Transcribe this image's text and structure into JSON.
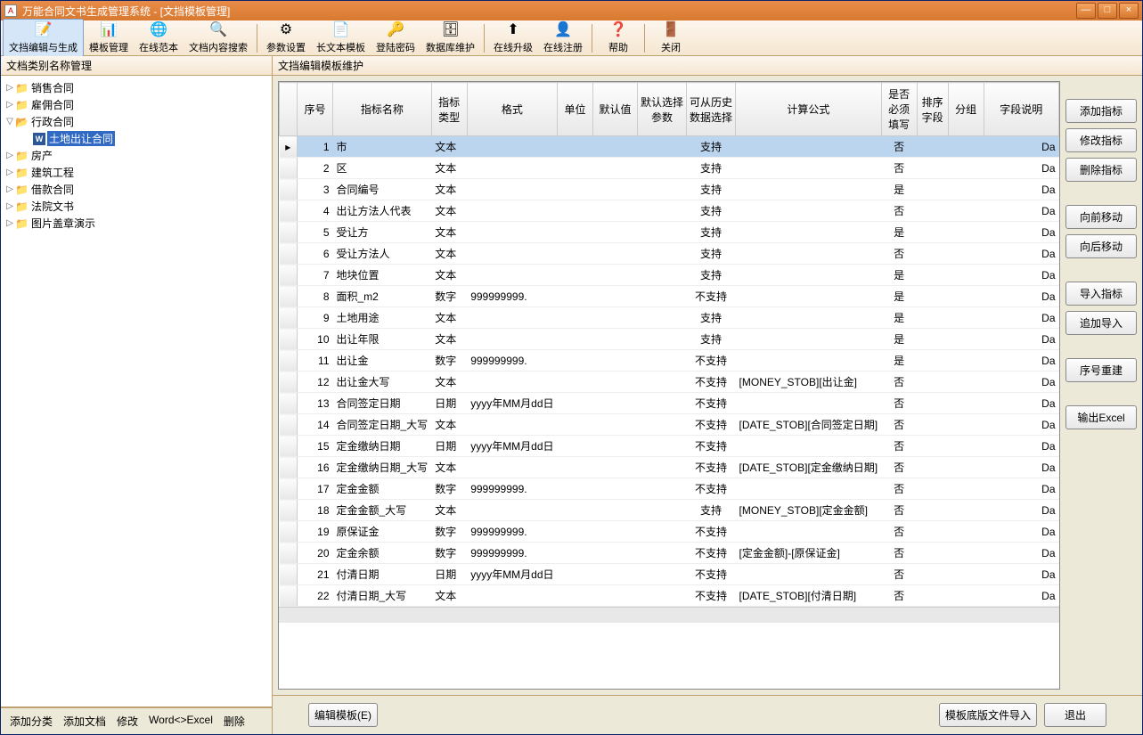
{
  "title": "万能合同文书生成管理系统 - [文挡模板管理]",
  "toolbar": [
    {
      "icon": "📝",
      "label": "文挡编辑与生成",
      "active": true
    },
    {
      "icon": "📊",
      "label": "模板管理"
    },
    {
      "icon": "🌐",
      "label": "在线范本"
    },
    {
      "icon": "🔍",
      "label": "文档内容搜索"
    },
    {
      "sep": true
    },
    {
      "icon": "⚙",
      "label": "参数设置"
    },
    {
      "icon": "📄",
      "label": "长文本模板"
    },
    {
      "icon": "🔑",
      "label": "登陆密码"
    },
    {
      "icon": "🗄",
      "label": "数据库维护"
    },
    {
      "sep": true
    },
    {
      "icon": "⬆",
      "label": "在线升级"
    },
    {
      "icon": "👤",
      "label": "在线注册"
    },
    {
      "sep": true
    },
    {
      "icon": "❓",
      "label": "帮助"
    },
    {
      "sep": true
    },
    {
      "icon": "🚪",
      "label": "关闭"
    }
  ],
  "leftHeader": "文档类别名称管理",
  "tree": [
    {
      "label": "销售合同",
      "icon": "📁",
      "toggle": "▷"
    },
    {
      "label": "雇佣合同",
      "icon": "📁",
      "toggle": "▷"
    },
    {
      "label": "行政合同",
      "icon": "📂",
      "toggle": "▽",
      "open": true,
      "children": [
        {
          "label": "土地出让合同",
          "icon": "W",
          "selected": true,
          "word": true
        }
      ]
    },
    {
      "label": "房产",
      "icon": "📁",
      "toggle": "▷"
    },
    {
      "label": "建筑工程",
      "icon": "📁",
      "toggle": "▷"
    },
    {
      "label": "借款合同",
      "icon": "📁",
      "toggle": "▷"
    },
    {
      "label": "法院文书",
      "icon": "📁",
      "toggle": "▷"
    },
    {
      "label": "图片盖章演示",
      "icon": "📁",
      "toggle": "▷"
    }
  ],
  "leftFooter": [
    "添加分类",
    "添加文档",
    "修改",
    "Word<>Excel",
    "删除"
  ],
  "rightHeader": "文挡编辑模板维护",
  "columns": [
    "序号",
    "指标名称",
    "指标类型",
    "格式",
    "单位",
    "默认值",
    "默认选择参数",
    "可从历史数据选择",
    "计算公式",
    "是否必须填写",
    "排序字段",
    "分组",
    "字段说明"
  ],
  "rows": [
    {
      "seq": 1,
      "name": "市",
      "type": "文本",
      "fmt": "",
      "hist": "支持",
      "calc": "",
      "req": "否",
      "desc": "Da",
      "sel": true
    },
    {
      "seq": 2,
      "name": "区",
      "type": "文本",
      "fmt": "",
      "hist": "支持",
      "calc": "",
      "req": "否",
      "desc": "Da"
    },
    {
      "seq": 3,
      "name": "合同编号",
      "type": "文本",
      "fmt": "",
      "hist": "支持",
      "calc": "",
      "req": "是",
      "desc": "Da"
    },
    {
      "seq": 4,
      "name": "出让方法人代表",
      "type": "文本",
      "fmt": "",
      "hist": "支持",
      "calc": "",
      "req": "否",
      "desc": "Da"
    },
    {
      "seq": 5,
      "name": "受让方",
      "type": "文本",
      "fmt": "",
      "hist": "支持",
      "calc": "",
      "req": "是",
      "desc": "Da"
    },
    {
      "seq": 6,
      "name": "受让方法人",
      "type": "文本",
      "fmt": "",
      "hist": "支持",
      "calc": "",
      "req": "否",
      "desc": "Da"
    },
    {
      "seq": 7,
      "name": "地块位置",
      "type": "文本",
      "fmt": "",
      "hist": "支持",
      "calc": "",
      "req": "是",
      "desc": "Da"
    },
    {
      "seq": 8,
      "name": "面积_m2",
      "type": "数字",
      "fmt": "999999999.",
      "hist": "不支持",
      "calc": "",
      "req": "是",
      "desc": "Da"
    },
    {
      "seq": 9,
      "name": "土地用途",
      "type": "文本",
      "fmt": "",
      "hist": "支持",
      "calc": "",
      "req": "是",
      "desc": "Da"
    },
    {
      "seq": 10,
      "name": "出让年限",
      "type": "文本",
      "fmt": "",
      "hist": "支持",
      "calc": "",
      "req": "是",
      "desc": "Da"
    },
    {
      "seq": 11,
      "name": "出让金",
      "type": "数字",
      "fmt": "999999999.",
      "hist": "不支持",
      "calc": "",
      "req": "是",
      "desc": "Da"
    },
    {
      "seq": 12,
      "name": "出让金大写",
      "type": "文本",
      "fmt": "",
      "hist": "不支持",
      "calc": "[MONEY_STOB][出让金]",
      "req": "否",
      "desc": "Da"
    },
    {
      "seq": 13,
      "name": "合同签定日期",
      "type": "日期",
      "fmt": "yyyy年MM月dd日",
      "hist": "不支持",
      "calc": "",
      "req": "否",
      "desc": "Da"
    },
    {
      "seq": 14,
      "name": "合同签定日期_大写",
      "type": "文本",
      "fmt": "",
      "hist": "不支持",
      "calc": "[DATE_STOB][合同签定日期]",
      "req": "否",
      "desc": "Da"
    },
    {
      "seq": 15,
      "name": "定金缴纳日期",
      "type": "日期",
      "fmt": "yyyy年MM月dd日",
      "hist": "不支持",
      "calc": "",
      "req": "否",
      "desc": "Da"
    },
    {
      "seq": 16,
      "name": "定金缴纳日期_大写",
      "type": "文本",
      "fmt": "",
      "hist": "不支持",
      "calc": "[DATE_STOB][定金缴纳日期]",
      "req": "否",
      "desc": "Da"
    },
    {
      "seq": 17,
      "name": "定金金额",
      "type": "数字",
      "fmt": "999999999.",
      "hist": "不支持",
      "calc": "",
      "req": "否",
      "desc": "Da"
    },
    {
      "seq": 18,
      "name": "定金金额_大写",
      "type": "文本",
      "fmt": "",
      "hist": "支持",
      "calc": "[MONEY_STOB][定金金额]",
      "req": "否",
      "desc": "Da"
    },
    {
      "seq": 19,
      "name": "原保证金",
      "type": "数字",
      "fmt": "999999999.",
      "hist": "不支持",
      "calc": "",
      "req": "否",
      "desc": "Da"
    },
    {
      "seq": 20,
      "name": "定金余额",
      "type": "数字",
      "fmt": "999999999.",
      "hist": "不支持",
      "calc": "[定金金额]-[原保证金]",
      "req": "否",
      "desc": "Da"
    },
    {
      "seq": 21,
      "name": "付清日期",
      "type": "日期",
      "fmt": "yyyy年MM月dd日",
      "hist": "不支持",
      "calc": "",
      "req": "否",
      "desc": "Da"
    },
    {
      "seq": 22,
      "name": "付清日期_大写",
      "type": "文本",
      "fmt": "",
      "hist": "不支持",
      "calc": "[DATE_STOB][付清日期]",
      "req": "否",
      "desc": "Da"
    }
  ],
  "sideButtons": [
    [
      "添加指标",
      "修改指标",
      "删除指标"
    ],
    [
      "向前移动",
      "向后移动"
    ],
    [
      "导入指标",
      "追加导入"
    ],
    [
      "序号重建"
    ],
    [
      "输出Excel"
    ]
  ],
  "bottom": {
    "edit": "编辑模板(E)",
    "import": "模板底版文件导入",
    "exit": "退出"
  }
}
